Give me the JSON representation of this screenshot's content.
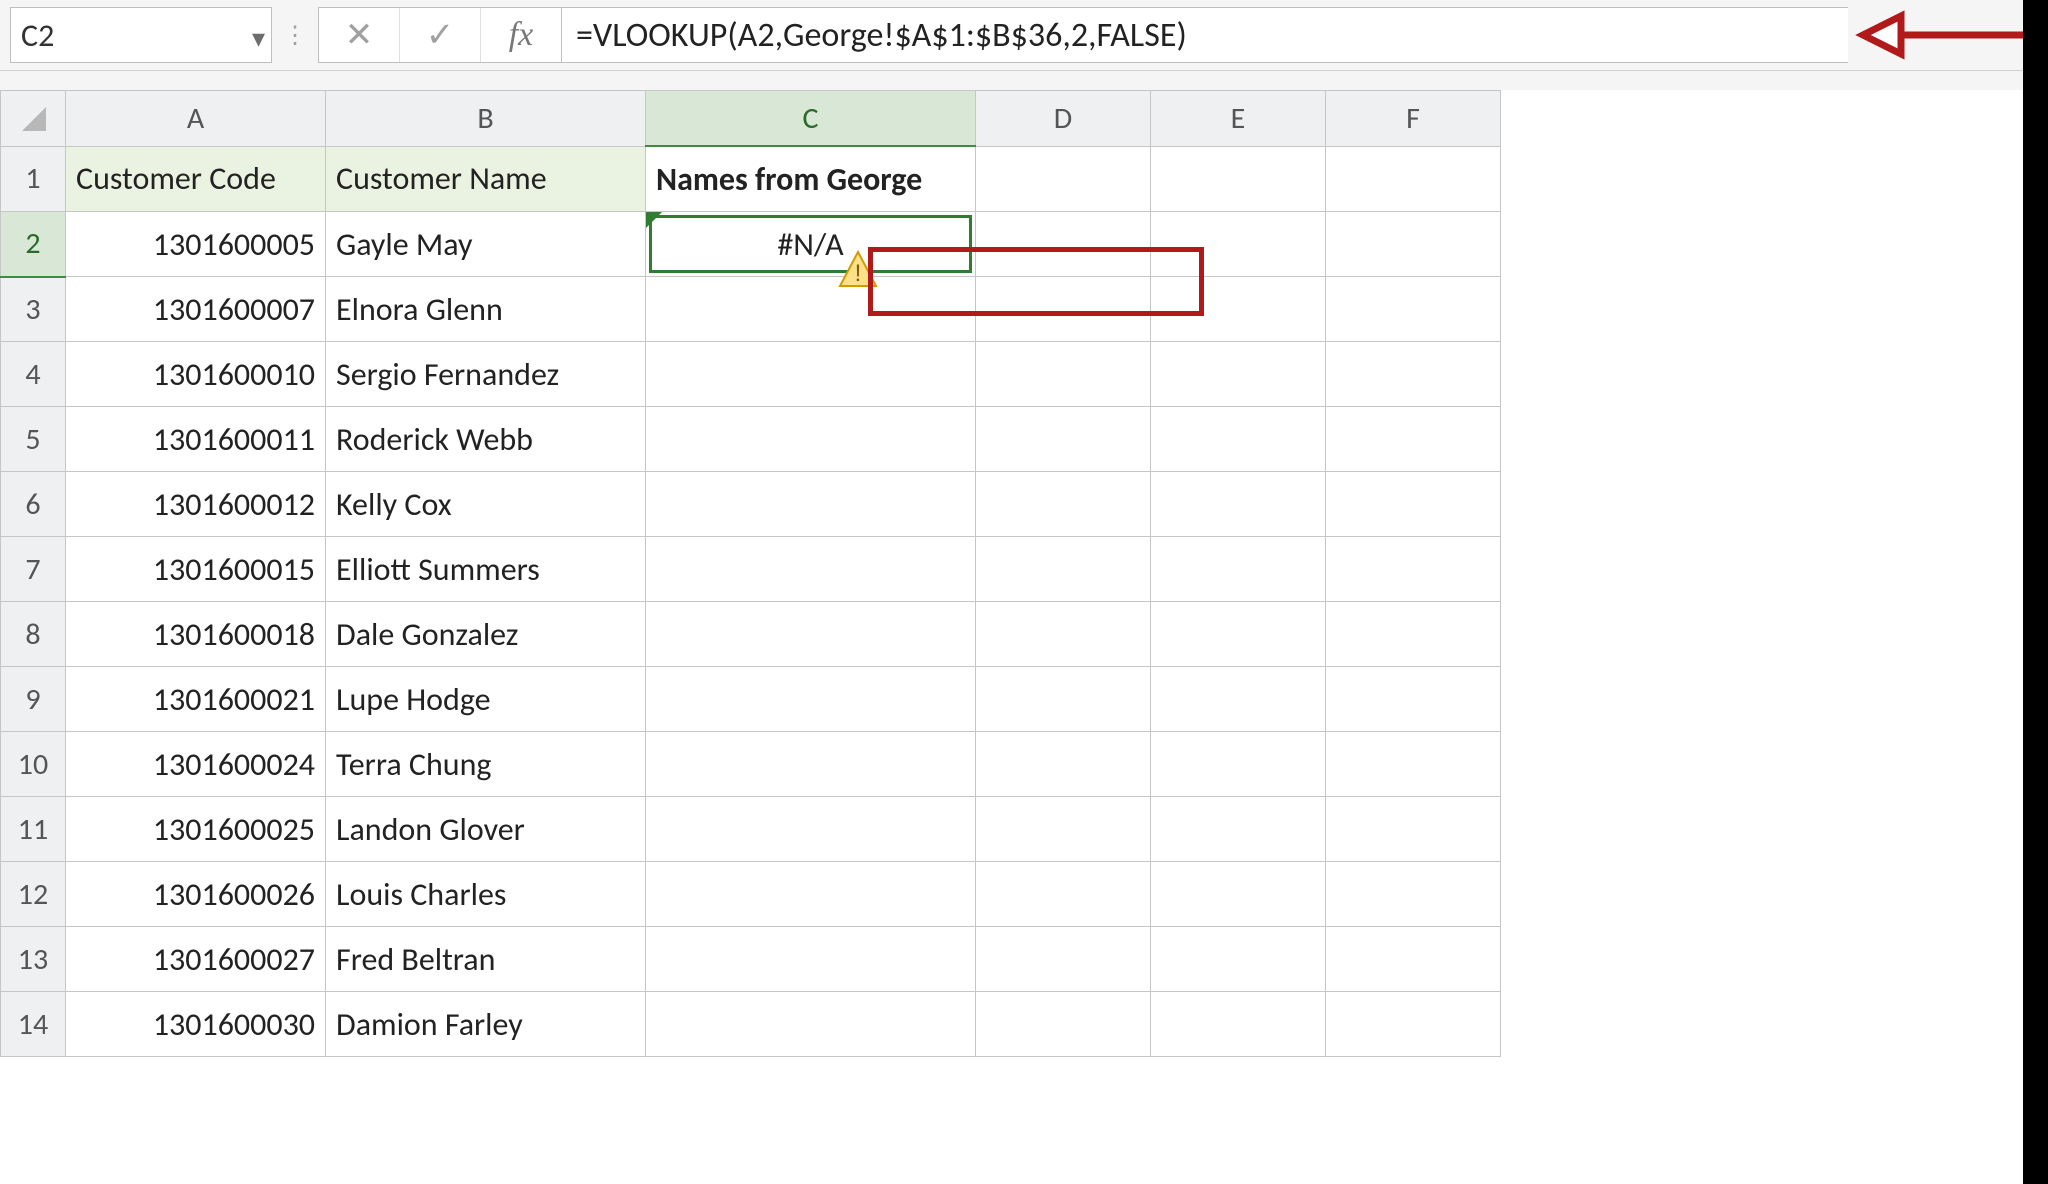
{
  "formula_bar": {
    "name_box_value": "C2",
    "cancel_icon": "✕",
    "enter_icon": "✓",
    "fx_label": "fx",
    "formula_text": "=VLOOKUP(A2,George!$A$1:$B$36,2,FALSE)"
  },
  "columns": {
    "A": "A",
    "B": "B",
    "C": "C",
    "D": "D",
    "E": "E",
    "F": "F"
  },
  "row_headers": [
    "1",
    "2",
    "3",
    "4",
    "5",
    "6",
    "7",
    "8",
    "9",
    "10",
    "11",
    "12",
    "13",
    "14"
  ],
  "headers": {
    "A1": "Customer Code",
    "B1": "Customer Name",
    "C1": "Names from George"
  },
  "rows": [
    {
      "code": "1301600005",
      "name": "Gayle May",
      "c": "#N/A"
    },
    {
      "code": "1301600007",
      "name": "Elnora Glenn",
      "c": ""
    },
    {
      "code": "1301600010",
      "name": "Sergio Fernandez",
      "c": ""
    },
    {
      "code": "1301600011",
      "name": "Roderick Webb",
      "c": ""
    },
    {
      "code": "1301600012",
      "name": "Kelly Cox",
      "c": ""
    },
    {
      "code": "1301600015",
      "name": "Elliott Summers",
      "c": ""
    },
    {
      "code": "1301600018",
      "name": "Dale Gonzalez",
      "c": ""
    },
    {
      "code": "1301600021",
      "name": "Lupe Hodge",
      "c": ""
    },
    {
      "code": "1301600024",
      "name": "Terra Chung",
      "c": ""
    },
    {
      "code": "1301600025",
      "name": "Landon Glover",
      "c": ""
    },
    {
      "code": "1301600026",
      "name": "Louis Charles",
      "c": ""
    },
    {
      "code": "1301600027",
      "name": "Fred Beltran",
      "c": ""
    },
    {
      "code": "1301600030",
      "name": "Damion Farley",
      "c": ""
    }
  ],
  "selected_cell": "C2",
  "annotations": {
    "formula_arrow": "red-left-arrow",
    "c2_highlight": "red-rectangle"
  },
  "icons": {
    "error_warning": "warning-triangle"
  }
}
